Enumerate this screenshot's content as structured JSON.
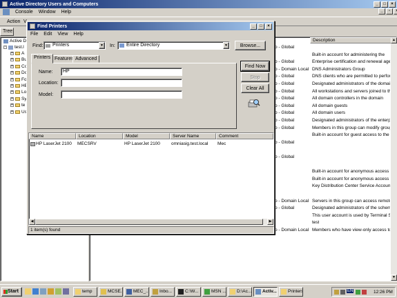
{
  "main_window": {
    "title": "Active Directory Users and Computers",
    "menu": [
      "Console",
      "Window",
      "Help"
    ],
    "toolbar": {
      "action_label": "Action",
      "view_label": "V"
    },
    "tree_tab": "Tree",
    "tree_root": "Active Dir",
    "tree_domain": "test.l",
    "tree_items": [
      "A",
      "Bu",
      "Co",
      "Do",
      "Fo",
      "HE",
      "Lo",
      "Sy",
      "te",
      "Us"
    ],
    "description_header": "Description",
    "rows": [
      {
        "type": "p - Global",
        "desc": ""
      },
      {
        "type": "",
        "desc": "Built-in account for administering the"
      },
      {
        "type": "p - Global",
        "desc": "Enterprise certification and renewal agents"
      },
      {
        "type": "p - Domain Local",
        "desc": "DNS Administrators Group"
      },
      {
        "type": "p - Global",
        "desc": "DNS clients who are permitted to perform dyn"
      },
      {
        "type": "p - Global",
        "desc": "Designated administrators of the domain"
      },
      {
        "type": "p - Global",
        "desc": "All workstations and servers joined to the dom"
      },
      {
        "type": "p - Global",
        "desc": "All domain controllers in the domain"
      },
      {
        "type": "p - Global",
        "desc": "All domain guests"
      },
      {
        "type": "p - Global",
        "desc": "All domain users"
      },
      {
        "type": "p - Global",
        "desc": "Designated administrators of the enterprise"
      },
      {
        "type": "p - Global",
        "desc": "Members in this group can modify group policy"
      },
      {
        "type": "",
        "desc": "Built-in account for guest access to the compu"
      },
      {
        "type": "p - Global",
        "desc": ""
      },
      {
        "type": "",
        "desc": ""
      },
      {
        "type": "p - Global",
        "desc": ""
      },
      {
        "type": "",
        "desc": ""
      },
      {
        "type": "",
        "desc": "Built-in account for anonymous access to Inte"
      },
      {
        "type": "",
        "desc": "Built-in account for anonymous access to Inte"
      },
      {
        "type": "",
        "desc": "Key Distribution Center Service Account"
      },
      {
        "type": "",
        "desc": ""
      },
      {
        "type": "p - Domain Local",
        "desc": "Servers in this group can access remote acce"
      },
      {
        "type": "p - Global",
        "desc": "Designated administrators of the schema"
      },
      {
        "type": "",
        "desc": "This user account is used by Terminal Services"
      },
      {
        "type": "",
        "desc": "test"
      },
      {
        "type": "p - Domain Local",
        "desc": "Members who have view-only access to the W"
      }
    ]
  },
  "dialog": {
    "title": "Find Printers",
    "menu": [
      "File",
      "Edit",
      "View",
      "Help"
    ],
    "find_label": "Find:",
    "find_value": "Printers",
    "in_label": "In:",
    "in_value": "Entire Directory",
    "browse_label": "Browse...",
    "tabs": [
      "Printers",
      "Features",
      "Advanced"
    ],
    "name_label": "Name:",
    "name_value": "HP",
    "location_label": "Location:",
    "location_value": "",
    "model_label": "Model:",
    "model_value": "",
    "find_now_label": "Find Now",
    "stop_label": "Stop",
    "clear_all_label": "Clear All",
    "columns": [
      "Name",
      "Location",
      "Model",
      "Server Name",
      "Comment"
    ],
    "results": [
      {
        "name": "HP LaserJet 2100",
        "location": "MECSRV",
        "model": "HP LaserJet 2100",
        "server": "omniasig.test.local",
        "comment": "Mec"
      }
    ],
    "status": "1 item(s) found"
  },
  "taskbar": {
    "start_label": "Start",
    "buttons": [
      {
        "label": "temp"
      },
      {
        "label": "MCSE..."
      },
      {
        "label": "MEC_..."
      },
      {
        "label": "Inbo..."
      },
      {
        "label": "C:\\W..."
      },
      {
        "label": "MSN ..."
      },
      {
        "label": "D:\\Ac..."
      },
      {
        "label": "Activ..."
      },
      {
        "label": "Printers"
      }
    ],
    "lang": "EN",
    "clock": "12:26 PM"
  }
}
